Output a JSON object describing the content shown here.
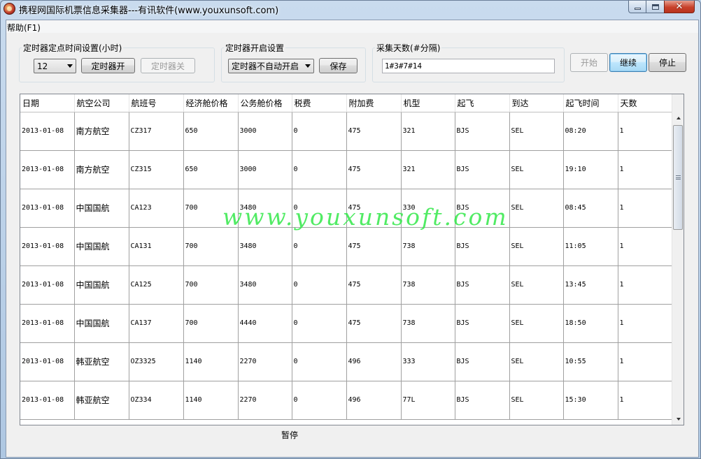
{
  "window": {
    "title": "携程网国际机票信息采集器---有讯软件(www.youxunsoft.com)"
  },
  "menu": {
    "help": "帮助(F1)"
  },
  "timer_schedule": {
    "group_label": "定时器定点时间设置(小时)",
    "hour_value": "12",
    "on_label": "定时器开",
    "off_label": "定时器关"
  },
  "timer_start": {
    "group_label": "定时器开启设置",
    "mode_value": "定时器不自动开启",
    "save_label": "保存"
  },
  "collect_days": {
    "group_label": "采集天数(#分隔)",
    "value": "1#3#7#14"
  },
  "actions": {
    "start_label": "开始",
    "continue_label": "继续",
    "stop_label": "停止"
  },
  "table": {
    "columns": [
      "日期",
      "航空公司",
      "航班号",
      "经济舱价格",
      "公务舱价格",
      "税费",
      "附加费",
      "机型",
      "起飞",
      "到达",
      "起飞时间",
      "天数"
    ],
    "rows": [
      [
        "2013-01-08",
        "南方航空",
        "CZ317",
        "650",
        "3000",
        "0",
        "475",
        "321",
        "BJS",
        "SEL",
        "08:20",
        "1"
      ],
      [
        "2013-01-08",
        "南方航空",
        "CZ315",
        "650",
        "3000",
        "0",
        "475",
        "321",
        "BJS",
        "SEL",
        "19:10",
        "1"
      ],
      [
        "2013-01-08",
        "中国国航",
        "CA123",
        "700",
        "3480",
        "0",
        "475",
        "330",
        "BJS",
        "SEL",
        "08:45",
        "1"
      ],
      [
        "2013-01-08",
        "中国国航",
        "CA131",
        "700",
        "3480",
        "0",
        "475",
        "738",
        "BJS",
        "SEL",
        "11:05",
        "1"
      ],
      [
        "2013-01-08",
        "中国国航",
        "CA125",
        "700",
        "3480",
        "0",
        "475",
        "738",
        "BJS",
        "SEL",
        "13:45",
        "1"
      ],
      [
        "2013-01-08",
        "中国国航",
        "CA137",
        "700",
        "4440",
        "0",
        "475",
        "738",
        "BJS",
        "SEL",
        "18:50",
        "1"
      ],
      [
        "2013-01-08",
        "韩亚航空",
        "OZ3325",
        "1140",
        "2270",
        "0",
        "496",
        "333",
        "BJS",
        "SEL",
        "10:55",
        "1"
      ],
      [
        "2013-01-08",
        "韩亚航空",
        "OZ334",
        "1140",
        "2270",
        "0",
        "496",
        "77L",
        "BJS",
        "SEL",
        "15:30",
        "1"
      ]
    ]
  },
  "watermark": "www.youxunsoft.com",
  "status": "暂停"
}
